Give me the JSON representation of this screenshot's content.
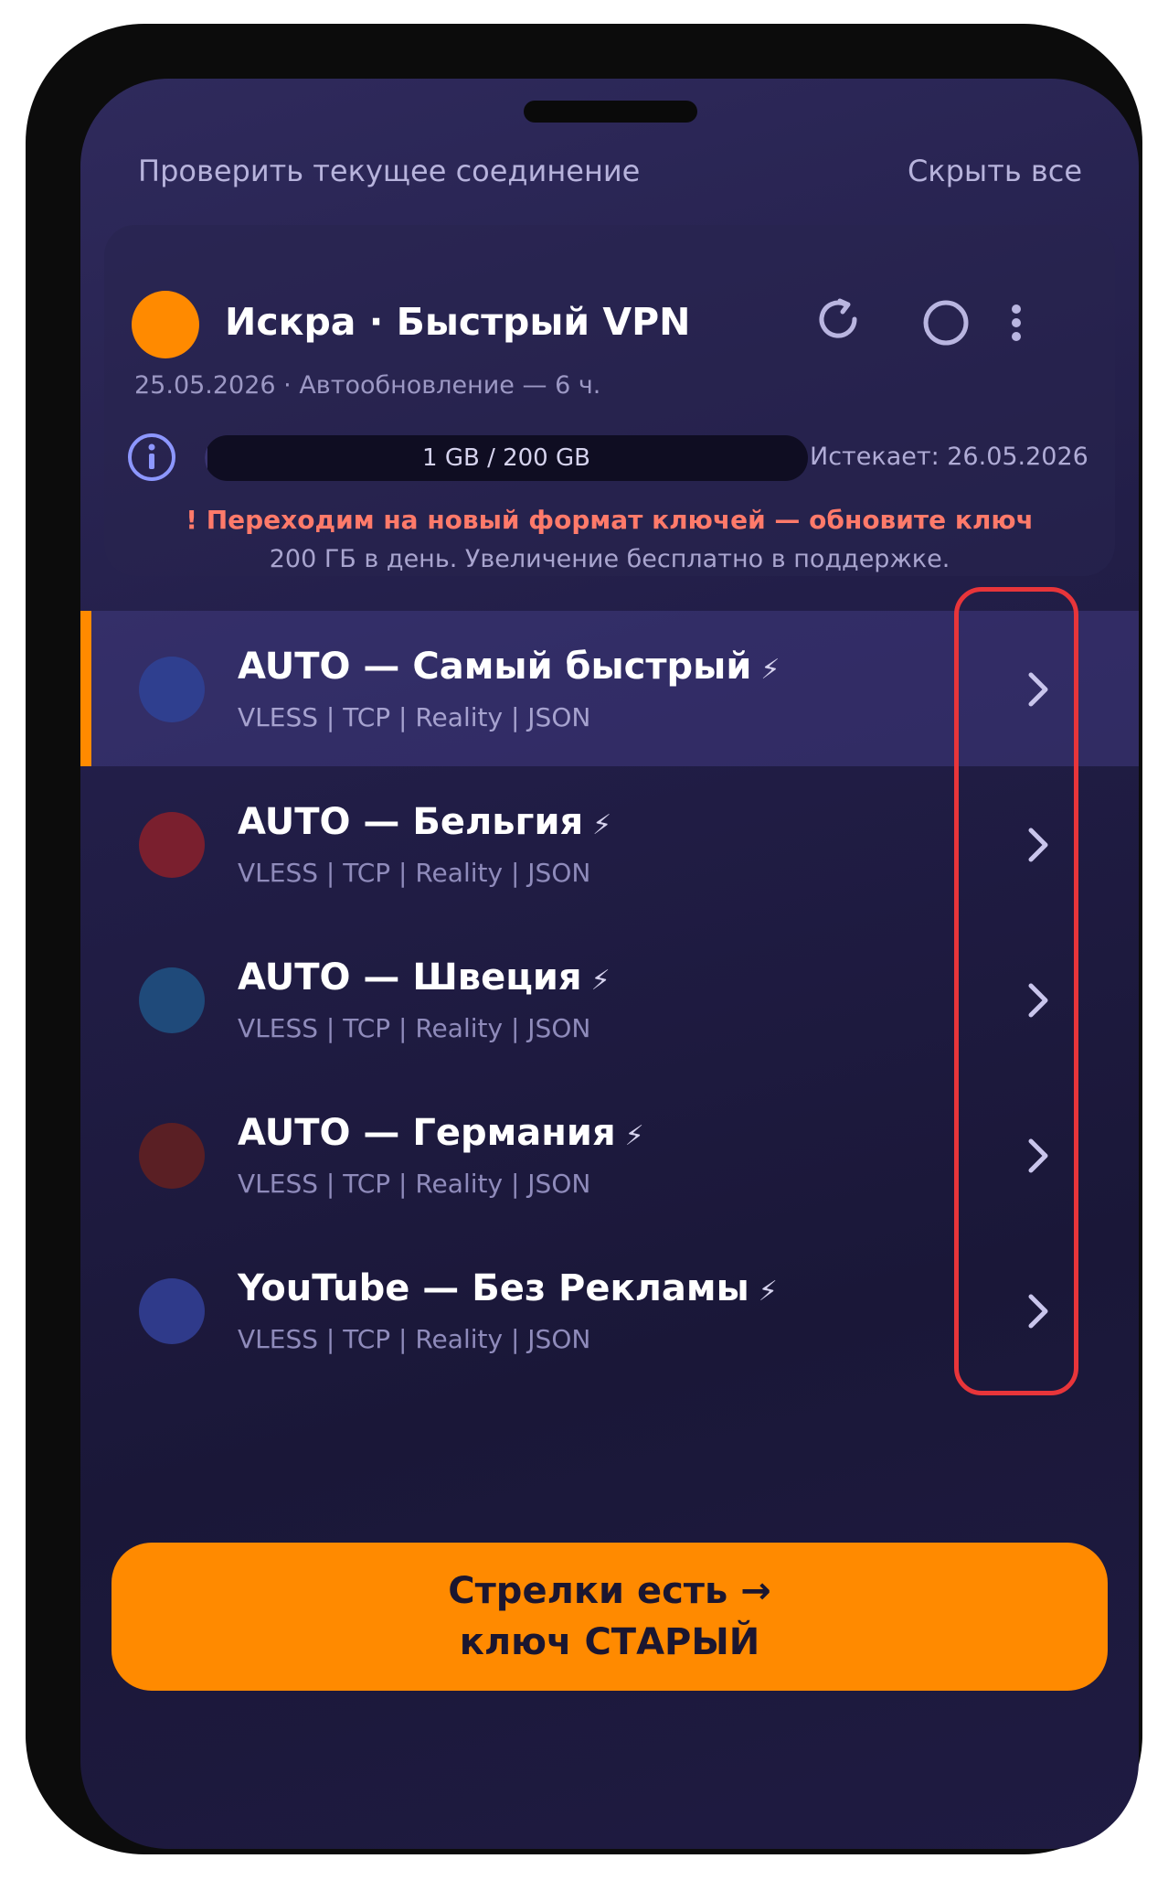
{
  "header": {
    "check_connection": "Проверить текущее соединение",
    "hide_all": "Скрыть все"
  },
  "subscription": {
    "title": "Искра · Быстрый VPN",
    "updated": "25.05.2026 · Автообновление — 6 ч.",
    "traffic_text": "1 GB / 200 GB",
    "traffic_used_fraction": 0.005,
    "expires": "Истекает: 26.05.2026",
    "warning": "! Переходим на новый формат ключей — обновите ключ",
    "notice": "200 ГБ в день. Увеличение бесплатно в поддержке."
  },
  "servers": [
    {
      "name": "AUTO — Самый быстрый",
      "meta": "VLESS | TCP | Reality | JSON",
      "color": "#2f3f8f",
      "active": true
    },
    {
      "name": "AUTO — Бельгия",
      "meta": "VLESS | TCP | Reality | JSON",
      "color": "#7a1f2e",
      "active": false
    },
    {
      "name": "AUTO — Швеция",
      "meta": "VLESS | TCP | Reality | JSON",
      "color": "#1f4a7a",
      "active": false
    },
    {
      "name": "AUTO — Германия",
      "meta": "VLESS | TCP | Reality | JSON",
      "color": "#5a1f24",
      "active": false
    },
    {
      "name": "YouTube — Без Рекламы",
      "meta": "VLESS | TCP | Reality | JSON",
      "color": "#2f3a8a",
      "active": false
    }
  ],
  "bolt_symbol": "⚡",
  "cta": {
    "line1": "Стрелки есть →",
    "line2": "ключ СТАРЫЙ"
  },
  "colors": {
    "accent": "#ff8a00",
    "highlight": "#e8353a",
    "warning": "#ff7a6a"
  }
}
